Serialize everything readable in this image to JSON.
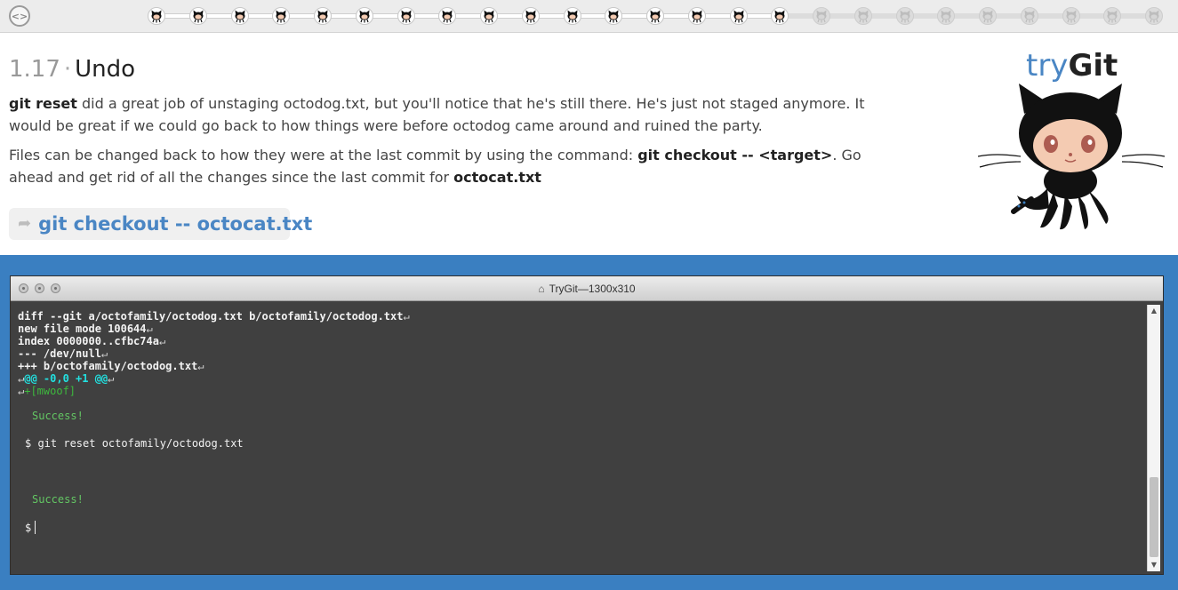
{
  "progress": {
    "total_steps": 25,
    "completed_steps": 16,
    "nav_icon": "code-brackets-icon"
  },
  "lesson": {
    "number": "1.17",
    "separator": "·",
    "title": "Undo",
    "p1_cmd": "git reset",
    "p1_text": " did a great job of unstaging octodog.txt, but you'll notice that he's still there. He's just not staged anymore. It would be great if we could go back to how things were before octodog came around and ruined the party.",
    "p2_text_a": "Files can be changed back to how they were at the last commit by using the command: ",
    "p2_cmd": "git checkout -- <target>",
    "p2_text_b": ". Go ahead and get rid of all the changes since the last commit for ",
    "p2_file": "octocat.txt",
    "hint_arrow": "➦",
    "hint_command": "git checkout -- octocat.txt"
  },
  "logo": {
    "try": "try",
    "git": "Git"
  },
  "terminal": {
    "title": "TryGit—1300x310",
    "home_icon": "⌂",
    "diff_lines": [
      "diff --git a/octofamily/octodog.txt b/octofamily/octodog.txt",
      "new file mode 100644",
      "index 0000000..cfbc74a",
      "--- /dev/null",
      "+++ b/octofamily/octodog.txt"
    ],
    "hunk_header": "@@ -0,0 +1 @@",
    "added_line": "+[mwoof]",
    "line_end_arrow": "↵",
    "success_1": "Success!",
    "command_1": "$ git reset octofamily/octodog.txt",
    "success_2": "Success!",
    "prompt": "$"
  },
  "colors": {
    "terminal_bg": "#404040",
    "page_accent": "#3a7fc1",
    "link_blue": "#4a86c4",
    "success_green": "#63c663",
    "diff_cyan": "#22e0e0"
  }
}
